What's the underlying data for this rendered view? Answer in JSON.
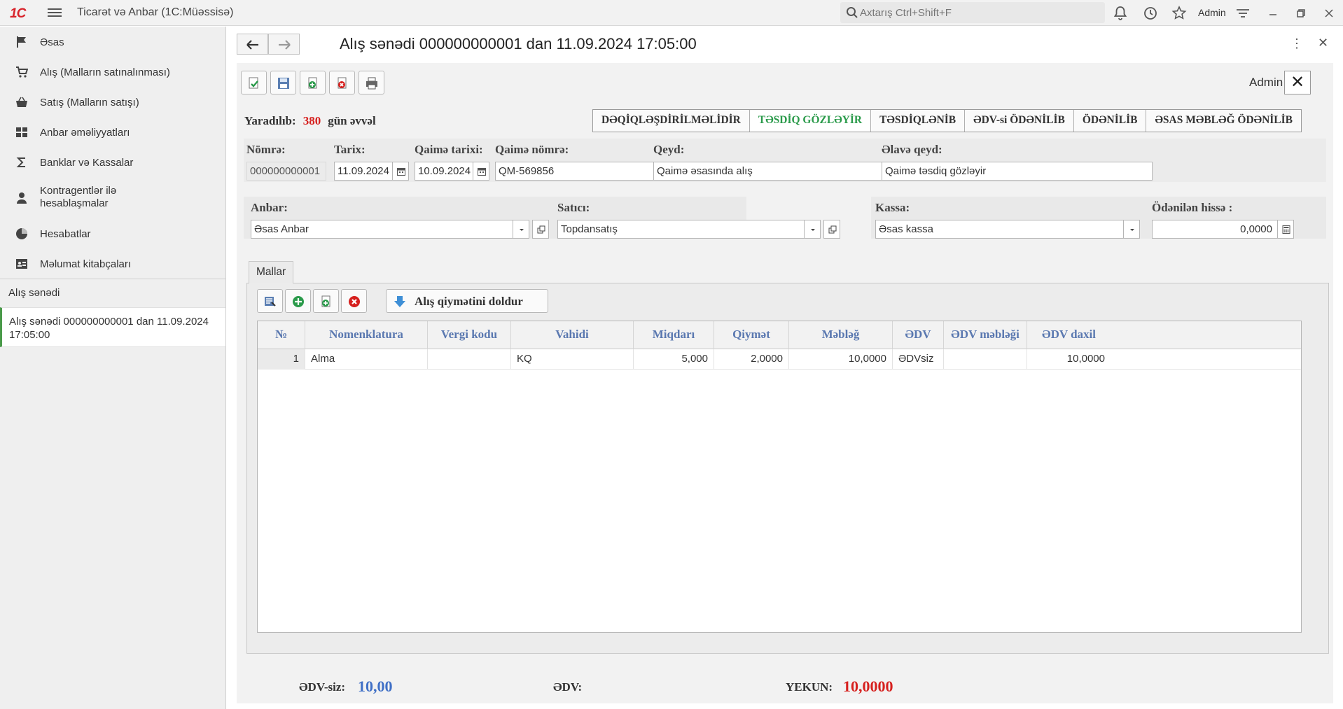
{
  "app": {
    "logo": "1C",
    "title": "Ticarət və Anbar  (1C:Müəssisə)",
    "search_placeholder": "Axtarış Ctrl+Shift+F",
    "user": "Admin"
  },
  "sidebar": {
    "items": [
      {
        "label": "Əsas",
        "icon": "flag-icon"
      },
      {
        "label": "Alış (Malların satınalınması)",
        "icon": "cart-icon"
      },
      {
        "label": "Satış (Malların satışı)",
        "icon": "basket-icon"
      },
      {
        "label": "Anbar əməliyyatları",
        "icon": "grid-icon"
      },
      {
        "label": "Banklar və Kassalar",
        "icon": "sigma-icon"
      },
      {
        "label": "Kontragentlər ilə hesablaşmalar",
        "icon": "person-icon"
      },
      {
        "label": "Hesabatlar",
        "icon": "pie-chart-icon"
      },
      {
        "label": "Məlumat kitabçaları",
        "icon": "address-book-icon"
      }
    ],
    "section": "Alış sənədi",
    "open_doc": "Alış sənədi 000000000001 dan 11.09.2024 17:05:00"
  },
  "document": {
    "title": "Alış sənədi 000000000001 dan 11.09.2024 17:05:00",
    "user": "Admin",
    "created_label": "Yaradılıb:",
    "created_days": "380",
    "created_suffix": "gün əvvəl",
    "statuses": [
      {
        "label": "DƏQİQLƏŞDİRİLMƏLİDİR",
        "active": false
      },
      {
        "label": "TƏSDİQ GÖZLƏYİR",
        "active": true
      },
      {
        "label": "TƏSDİQLƏNİB",
        "active": false
      },
      {
        "label": "ƏDV-si ÖDƏNİLİB",
        "active": false
      },
      {
        "label": "ÖDƏNİLİB",
        "active": false
      },
      {
        "label": "ƏSAS MƏBLƏĞ ÖDƏNİLİB",
        "active": false
      }
    ],
    "fields": {
      "number_label": "Nömrə:",
      "number": "000000000001",
      "date_label": "Tarix:",
      "date": "11.09.2024",
      "invoice_date_label": "Qaimə tarixi:",
      "invoice_date": "10.09.2024",
      "invoice_number_label": "Qaimə nömrə:",
      "invoice_number": "QM-569856",
      "note_label": "Qeyd:",
      "note": "Qaimə əsasında alış",
      "extra_note_label": "Əlavə qeyd:",
      "extra_note": "Qaimə təsdiq gözləyir",
      "warehouse_label": "Anbar:",
      "warehouse": "Əsas Anbar",
      "seller_label": "Satıcı:",
      "seller": "Topdansatış",
      "cashbox_label": "Kassa:",
      "cashbox": "Əsas kassa",
      "paid_label": "Ödənilən hissə :",
      "paid": "0,0000"
    },
    "goods_tab": "Mallar",
    "fill_price_button": "Alış qiymətini doldur",
    "table": {
      "columns": [
        "№",
        "Nomenklatura",
        "Vergi kodu",
        "Vahidi",
        "Miqdarı",
        "Qiymət",
        "Məbləğ",
        "ƏDV",
        "ƏDV məbləği",
        "ƏDV daxil"
      ],
      "rows": [
        [
          "1",
          "Alma",
          "",
          "KQ",
          "5,000",
          "2,0000",
          "10,0000",
          "ƏDVsiz",
          "",
          "10,0000"
        ]
      ]
    },
    "totals": {
      "no_vat_label": "ƏDV-siz:",
      "no_vat": "10,00",
      "vat_label": "ƏDV:",
      "vat": "",
      "total_label": "YEKUN:",
      "total": "10,0000"
    }
  },
  "colors": {
    "accent_green": "#2a9a4a",
    "days_red": "#d6201e",
    "header_blue": "#5a78b0",
    "total_blue": "#3f6fc6"
  }
}
